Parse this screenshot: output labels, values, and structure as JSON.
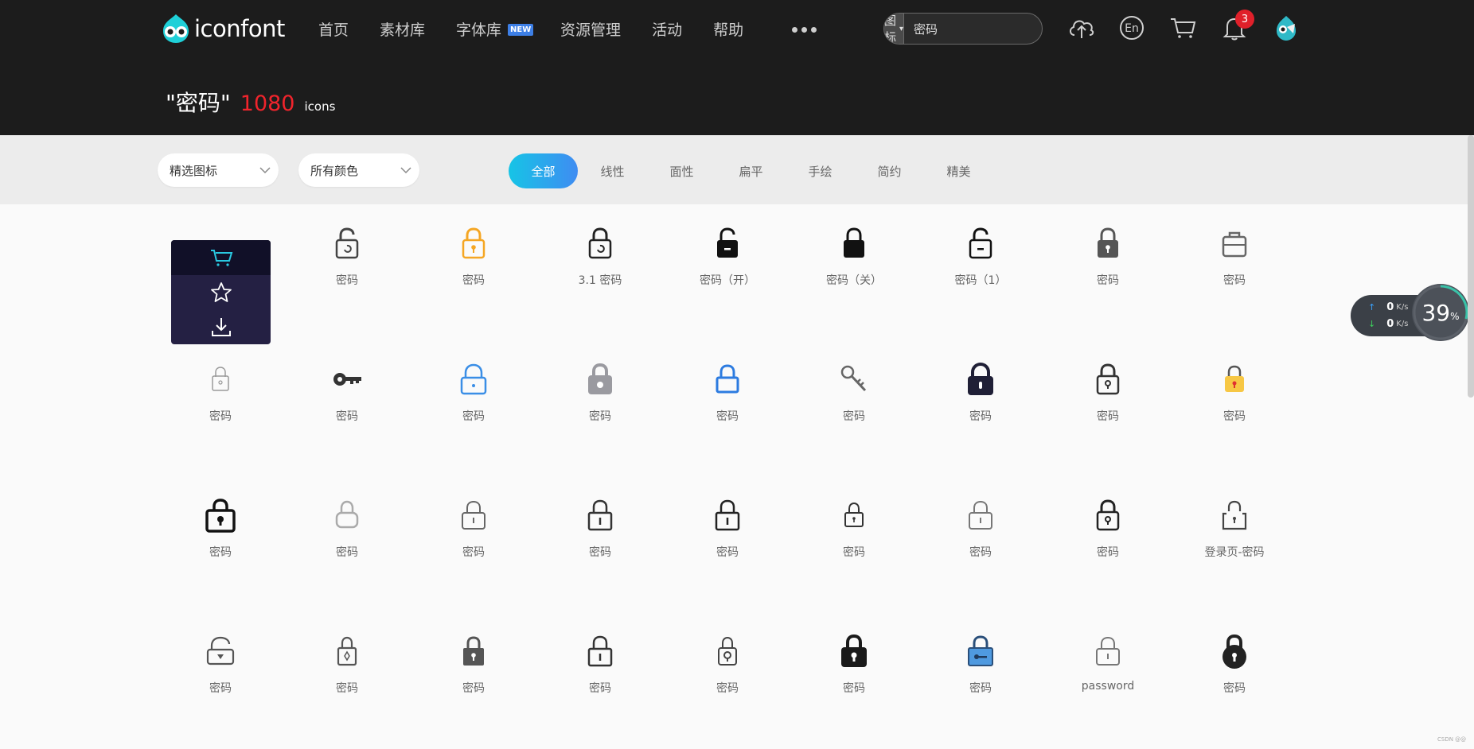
{
  "brand": {
    "name": "iconfont"
  },
  "nav": [
    {
      "label": "首页"
    },
    {
      "label": "素材库"
    },
    {
      "label": "字体库",
      "badge": "NEW"
    },
    {
      "label": "资源管理"
    },
    {
      "label": "活动"
    },
    {
      "label": "帮助"
    }
  ],
  "search": {
    "type": "图标",
    "value": "密码"
  },
  "notifications": {
    "count": "3"
  },
  "result": {
    "query": "\"密码\"",
    "count": "1080",
    "unit": "icons"
  },
  "filters": {
    "dropdown1": "精选图标",
    "dropdown2": "所有颜色",
    "tabs": [
      "全部",
      "线性",
      "面性",
      "扁平",
      "手绘",
      "简约",
      "精美"
    ],
    "active_tab": "全部"
  },
  "icons": [
    {
      "label": "",
      "icon": "hover-actions"
    },
    {
      "label": "密码",
      "icon": "lock-open-refresh-icon",
      "color": "#444444"
    },
    {
      "label": "密码",
      "icon": "lock-keyhole-icon",
      "color": "#f5a623"
    },
    {
      "label": "3.1 密码",
      "icon": "lock-refresh-icon",
      "color": "#222222"
    },
    {
      "label": "密码（开）",
      "icon": "lock-open-solid-icon",
      "color": "#111111"
    },
    {
      "label": "密码（关）",
      "icon": "lock-solid-icon",
      "color": "#111111"
    },
    {
      "label": "密码（1）",
      "icon": "lock-open-outline-icon",
      "color": "#111111"
    },
    {
      "label": "密码",
      "icon": "lock-solid-keyhole-icon",
      "color": "#555555"
    },
    {
      "label": "密码",
      "icon": "toolbox-lock-icon",
      "color": "#666666"
    },
    {
      "label": "密码",
      "icon": "lock-thin-icon",
      "color": "#999999"
    },
    {
      "label": "密码",
      "icon": "key-icon",
      "color": "#333333"
    },
    {
      "label": "密码",
      "icon": "lock-outline-dot-icon",
      "color": "#3a8ee6"
    },
    {
      "label": "密码",
      "icon": "lock-gray-solid-icon",
      "color": "#9a9aa0"
    },
    {
      "label": "密码",
      "icon": "lock-outline-blue-icon",
      "color": "#2c7be0"
    },
    {
      "label": "密码",
      "icon": "key-outline-icon",
      "color": "#666666"
    },
    {
      "label": "密码",
      "icon": "lock-dark-navy-icon",
      "color": "#1f1f36"
    },
    {
      "label": "密码",
      "icon": "lock-keyhole-outline-icon",
      "color": "#333333"
    },
    {
      "label": "密码",
      "icon": "lock-yellow-icon",
      "color": "#f7c744"
    },
    {
      "label": "密码",
      "icon": "lock-bold-keyhole-icon",
      "color": "#111111"
    },
    {
      "label": "密码",
      "icon": "lock-light-icon",
      "color": "#aaaaaa"
    },
    {
      "label": "密码",
      "icon": "lock-line-icon",
      "color": "#666666"
    },
    {
      "label": "密码",
      "icon": "lock-line-dark-icon",
      "color": "#333333"
    },
    {
      "label": "密码",
      "icon": "lock-line-dark-icon",
      "color": "#222222"
    },
    {
      "label": "密码",
      "icon": "lock-small-keyhole-icon",
      "color": "#333333"
    },
    {
      "label": "密码",
      "icon": "lock-line-icon",
      "color": "#777777"
    },
    {
      "label": "密码",
      "icon": "lock-keyhole-outline-icon",
      "color": "#222222"
    },
    {
      "label": "登录页-密码",
      "icon": "lock-dashed-icon",
      "color": "#444444"
    },
    {
      "label": "密码",
      "icon": "lock-open-wide-icon",
      "color": "#555555"
    },
    {
      "label": "密码",
      "icon": "lock-diamond-icon",
      "color": "#555555"
    },
    {
      "label": "密码",
      "icon": "lock-solid-gray-icon",
      "color": "#555555"
    },
    {
      "label": "密码",
      "icon": "lock-line-dark-icon",
      "color": "#333333"
    },
    {
      "label": "密码",
      "icon": "lock-circle-keyhole-icon",
      "color": "#444444"
    },
    {
      "label": "密码",
      "icon": "lock-solid-black-icon",
      "color": "#1a1a1a"
    },
    {
      "label": "密码",
      "icon": "lock-blue-key-icon",
      "color": "#4f9ae0"
    },
    {
      "label": "password",
      "icon": "lock-line-icon",
      "color": "#777777"
    },
    {
      "label": "密码",
      "icon": "lock-round-solid-icon",
      "color": "#222222"
    }
  ],
  "speed_widget": {
    "up": "0",
    "down": "0",
    "unit": "K/s",
    "percent": "39",
    "percent_unit": "%"
  },
  "credit": "CSDN @@"
}
